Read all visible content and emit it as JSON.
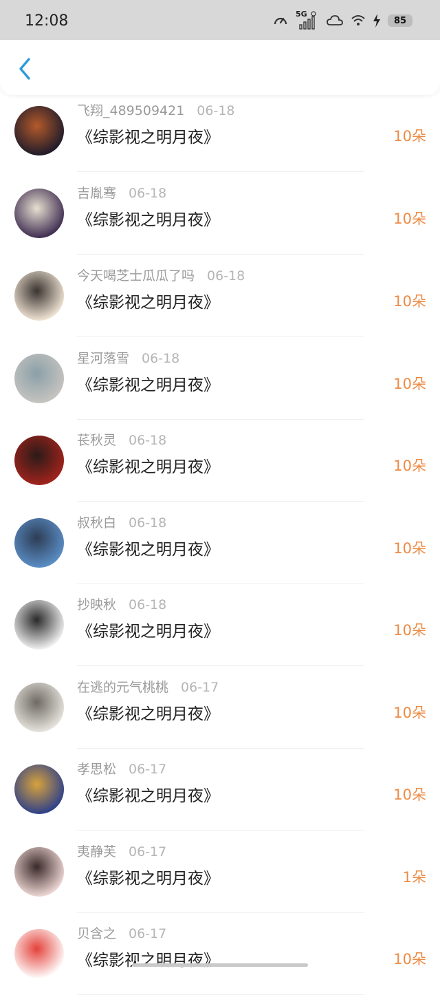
{
  "status_bar": {
    "time": "12:08",
    "network": "5G",
    "battery": "85"
  },
  "header": {
    "back_icon": "chevron-left-icon",
    "accent_color": "#2b9bd8"
  },
  "items": [
    {
      "name": "飞翔_489509421",
      "date": "06-18",
      "title": "《综影视之明月夜》",
      "amount": "10朵",
      "avatar_colors": [
        "#1d1a2a",
        "#b35a2a"
      ]
    },
    {
      "name": "吉胤骞",
      "date": "06-18",
      "title": "《综影视之明月夜》",
      "amount": "10朵",
      "avatar_colors": [
        "#3d2a4f",
        "#e6e0d0"
      ]
    },
    {
      "name": "今天喝芝士瓜瓜了吗",
      "date": "06-18",
      "title": "《综影视之明月夜》",
      "amount": "10朵",
      "avatar_colors": [
        "#f3e6d6",
        "#3a3430"
      ]
    },
    {
      "name": "星河落雪",
      "date": "06-18",
      "title": "《综影视之明月夜》",
      "amount": "10朵",
      "avatar_colors": [
        "#c7c4c0",
        "#8aa0a8"
      ]
    },
    {
      "name": "苌秋灵",
      "date": "06-18",
      "title": "《综影视之明月夜》",
      "amount": "10朵",
      "avatar_colors": [
        "#a3231d",
        "#2b1b18"
      ]
    },
    {
      "name": "叔秋白",
      "date": "06-18",
      "title": "《综影视之明月夜》",
      "amount": "10朵",
      "avatar_colors": [
        "#5b8fc7",
        "#2d3d55"
      ]
    },
    {
      "name": "抄映秋",
      "date": "06-18",
      "title": "《综影视之明月夜》",
      "amount": "10朵",
      "avatar_colors": [
        "#f4f4f4",
        "#2a2a2a"
      ]
    },
    {
      "name": "在逃的元气桃桃",
      "date": "06-17",
      "title": "《综影视之明月夜》",
      "amount": "10朵",
      "avatar_colors": [
        "#e9e5df",
        "#6f6a64"
      ]
    },
    {
      "name": "孝思松",
      "date": "06-17",
      "title": "《综影视之明月夜》",
      "amount": "10朵",
      "avatar_colors": [
        "#2b3f8a",
        "#d8a23c"
      ]
    },
    {
      "name": "夷静芙",
      "date": "06-17",
      "title": "《综影视之明月夜》",
      "amount": "1朵",
      "avatar_colors": [
        "#f1d9d6",
        "#3a2a2a"
      ]
    },
    {
      "name": "贝含之",
      "date": "06-17",
      "title": "《综影视之明月夜》",
      "amount": "10朵",
      "avatar_colors": [
        "#ffffff",
        "#e4423a"
      ]
    }
  ],
  "colors": {
    "amount": "#ec8b45",
    "name": "#9a9a9a",
    "title": "#222222"
  }
}
